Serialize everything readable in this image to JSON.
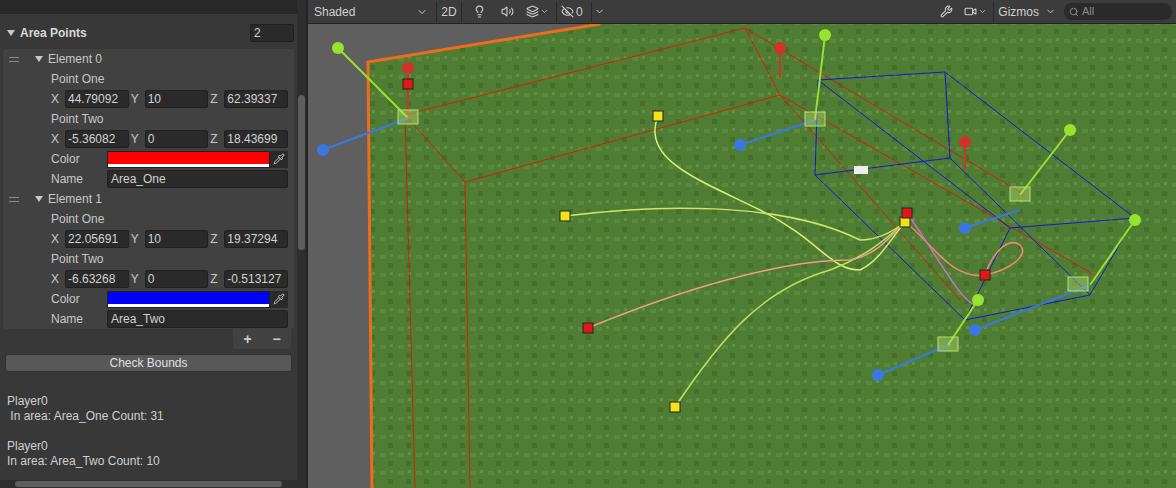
{
  "inspector": {
    "list_title": "Area Points",
    "count": "2",
    "elements": [
      {
        "label": "Element 0",
        "expanded": true,
        "points": [
          {
            "label": "Point One",
            "x": "44.79092",
            "y": "10",
            "z": "62.39337"
          },
          {
            "label": "Point Two",
            "x": "-5.36082",
            "y": "0",
            "z": "18.43699"
          }
        ],
        "color_label": "Color",
        "color": "#ff0000",
        "name_label": "Name",
        "name": "Area_One"
      },
      {
        "label": "Element 1",
        "expanded": true,
        "points": [
          {
            "label": "Point One",
            "x": "22.05691",
            "y": "10",
            "z": "19.37294"
          },
          {
            "label": "Point Two",
            "x": "-6.63268",
            "y": "0",
            "z": "-0.513127"
          }
        ],
        "color_label": "Color",
        "color": "#0000ff",
        "name_label": "Name",
        "name": "Area_Two"
      }
    ],
    "axis_labels": [
      "X",
      "Y",
      "Z"
    ],
    "add_button": "+",
    "remove_button": "−",
    "check_button": "Check Bounds",
    "log": [
      {
        "player": "Player0",
        "text": " In area: Area_One Count: 31"
      },
      {
        "player": "Player0",
        "text": "In area: Area_Two Count: 10"
      }
    ]
  },
  "toolbar": {
    "shading": "Shaded",
    "mode_2d": "2D",
    "hidden_count": "0",
    "gizmos": "Gizmos",
    "search_placeholder": "All"
  }
}
